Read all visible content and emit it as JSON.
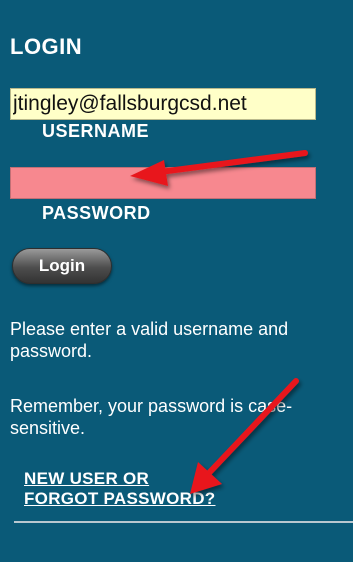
{
  "login": {
    "title": "LOGIN",
    "username_value": "jtingley@fallsburgcsd.net",
    "username_label": "USERNAME",
    "password_value": "",
    "password_label": "PASSWORD",
    "login_button": "Login",
    "error_message": "Please enter a valid username and password.",
    "case_note": "Remember, your password is case-sensitive.",
    "new_user_link_line1": "NEW USER OR",
    "new_user_link_line2": "FORGOT PASSWORD?"
  },
  "colors": {
    "panel_bg": "#0a5a78",
    "username_bg": "#ffffc8",
    "password_bg": "#f7888f",
    "annotation_arrow": "#e8191f"
  },
  "annotations": {
    "arrow_icon": "red-arrow-icon"
  }
}
